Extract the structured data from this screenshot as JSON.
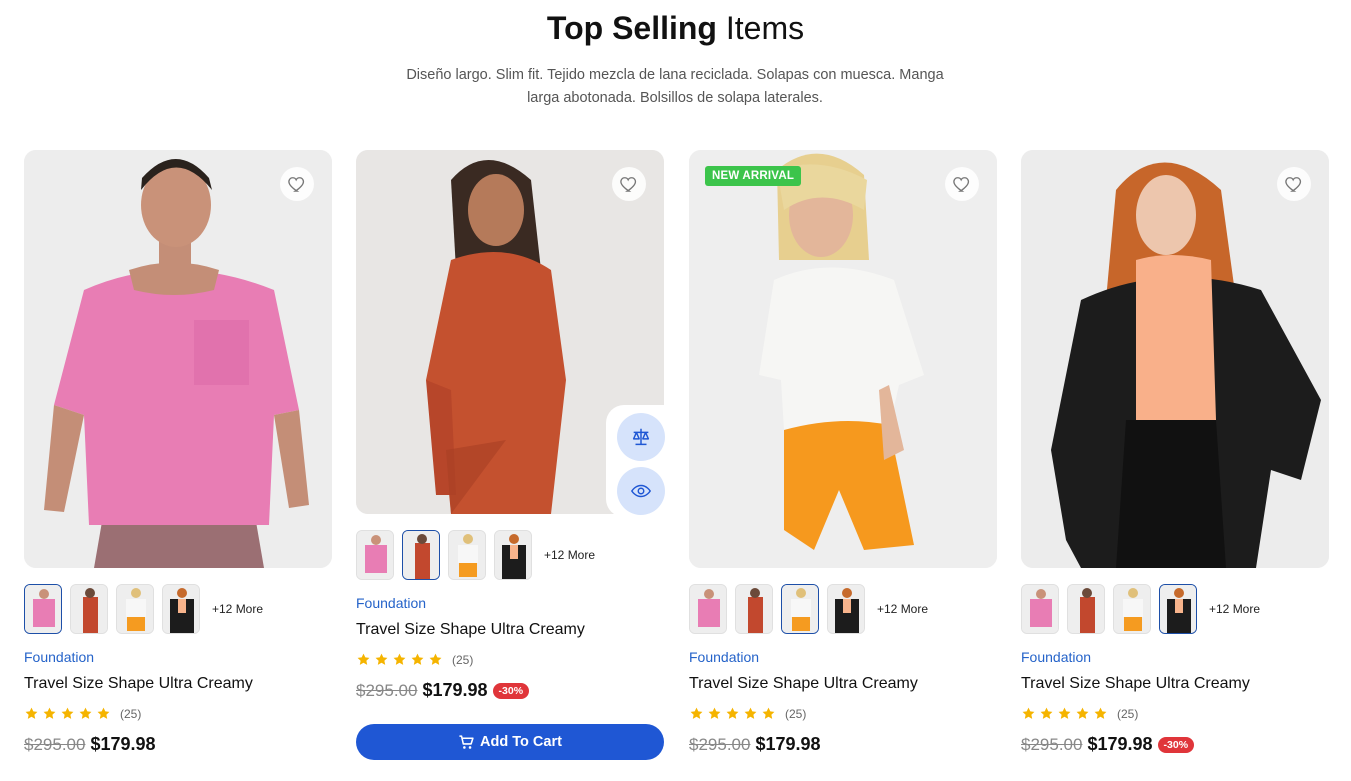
{
  "header": {
    "title_bold": "Top Selling",
    "title_light": "Items",
    "subtitle": "Diseño largo. Slim fit. Tejido mezcla de lana reciclada. Solapas con muesca. Manga larga abotonada. Bolsillos de solapa laterales."
  },
  "colors": {
    "accent": "#1f57d4",
    "brand_text": "#2563c9",
    "star": "#f5b400",
    "discount": "#e0353a",
    "new_badge": "#3cc44b"
  },
  "products": [
    {
      "brand": "Foundation",
      "name": "Travel Size Shape Ultra Creamy",
      "rating_stars": 5,
      "review_count": "(25)",
      "old_price": "$295.00",
      "price": "$179.98",
      "discount": "",
      "badge": "",
      "more_label": "+12 More",
      "active_thumb": 0
    },
    {
      "brand": "Foundation",
      "name": "Travel Size Shape Ultra Creamy",
      "rating_stars": 5,
      "review_count": "(25)",
      "old_price": "$295.00",
      "price": "$179.98",
      "discount": "-30%",
      "badge": "",
      "more_label": "+12 More",
      "active_thumb": 1,
      "cart_label": "Add To Cart"
    },
    {
      "brand": "Foundation",
      "name": "Travel Size Shape Ultra Creamy",
      "rating_stars": 5,
      "review_count": "(25)",
      "old_price": "$295.00",
      "price": "$179.98",
      "discount": "",
      "badge": "NEW ARRIVAL",
      "more_label": "+12 More",
      "active_thumb": 2
    },
    {
      "brand": "Foundation",
      "name": "Travel Size Shape Ultra Creamy",
      "rating_stars": 5,
      "review_count": "(25)",
      "old_price": "$295.00",
      "price": "$179.98",
      "discount": "-30%",
      "badge": "",
      "more_label": "+12 More",
      "active_thumb": 3
    }
  ],
  "icons": {
    "wishlist": "heart-icon",
    "compare": "scale-icon",
    "quick_view": "eye-icon",
    "cart": "cart-icon",
    "rating": "star-icon"
  }
}
